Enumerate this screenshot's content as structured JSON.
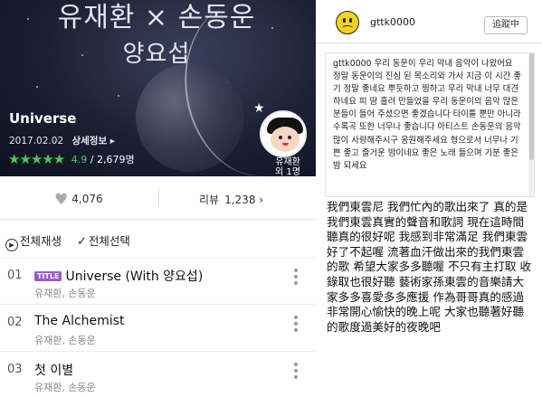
{
  "album": {
    "cover_line1": "유재환 × 손동운",
    "cover_line2": "양요섭",
    "title": "Universe",
    "date": "2017.02.02",
    "detail_link": "상세정보 ▸",
    "stars": "★★★★★",
    "score": "4.9",
    "rating_count": "/ 2,679명",
    "artist_name": "유재환",
    "artist_extra": "외 1명"
  },
  "stats": {
    "likes": "4,076",
    "review_label": "리뷰",
    "review_count": "1,238 ›"
  },
  "playbar": {
    "play_all": "전체재생",
    "select_all": "전체선택"
  },
  "tracks": [
    {
      "num": "01",
      "badge": "TITLE",
      "title": "Universe (With 양요섭)",
      "artist": "유재환, 손동운"
    },
    {
      "num": "02",
      "title": "The Alchemist",
      "artist": "유재환, 손동운"
    },
    {
      "num": "03",
      "title": "첫 이별",
      "artist": "유재환, 손동운"
    }
  ],
  "comment": {
    "username": "gttk0000",
    "follow_label": "追蹤中",
    "post": "gttk0000 우리 동운이 우리 막내 음악이 나왔어요 정말 동운이의 진심 된 목소리와 가사 지금 이 시간 좋기 정말 좋네요 뿌듯하고 찡하고 우리 막내 너무 대견 하네요 피 땀 흘려 만들었을 우리 동운이의 음악 많은 분들이 들어 주셨으면 좋겠습니다 타이틀 뿐만 아니라 수록곡 또한 너무나 좋습니다 아티스트 손동운의 음악 많이 사랑해주시구 응원해주세요 형으로서 너무나 기쁜 좋고 즐거운 밤이네요 좋은 노래 들으며 기분 좋은 밤 되세요",
    "translation": "我們東雲尼 我們忙內的歌出來了 真的是我們東雲真實的聲音和歌詞 現在這時間聽真的很好呢 我感到非常滿足 我們東雲好了不起喔 流著血汗做出來的我們東雲的歌 希望大家多多聽喔 不只有主打取 收錄取也很好聽 藝術家孫東雲的音樂請大家多多喜愛多多應援 作為哥哥真的感過非常開心愉快的晚上呢 大家也聽著好聽的歌度過美好的夜晚吧"
  },
  "colors": {
    "accent_green": "#3bd04d",
    "title_badge": "#9b59d0",
    "user_icon": "#f7d21d"
  },
  "icons": [
    "heart-icon",
    "play-circle-icon",
    "check-icon",
    "more-vertical-icon",
    "sad-face-icon",
    "star-icon"
  ]
}
